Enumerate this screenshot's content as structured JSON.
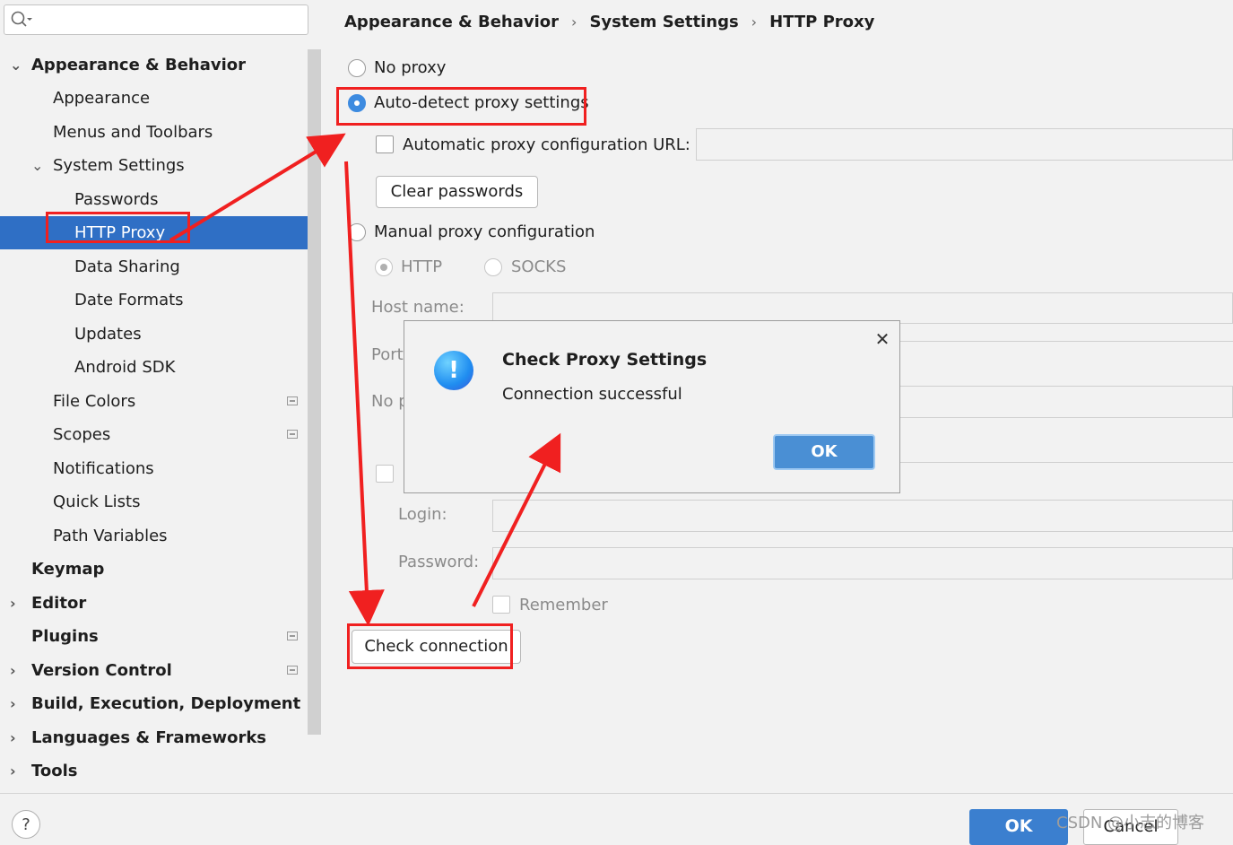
{
  "sidebar": {
    "items": [
      {
        "label": "Appearance & Behavior",
        "bold": true,
        "expanded": true
      },
      {
        "label": "Appearance"
      },
      {
        "label": "Menus and Toolbars"
      },
      {
        "label": "System Settings",
        "expanded": true
      },
      {
        "label": "Passwords"
      },
      {
        "label": "HTTP Proxy",
        "selected": true
      },
      {
        "label": "Data Sharing"
      },
      {
        "label": "Date Formats"
      },
      {
        "label": "Updates"
      },
      {
        "label": "Android SDK"
      },
      {
        "label": "File Colors"
      },
      {
        "label": "Scopes"
      },
      {
        "label": "Notifications"
      },
      {
        "label": "Quick Lists"
      },
      {
        "label": "Path Variables"
      },
      {
        "label": "Keymap",
        "bold": true
      },
      {
        "label": "Editor",
        "bold": true
      },
      {
        "label": "Plugins",
        "bold": true
      },
      {
        "label": "Version Control",
        "bold": true
      },
      {
        "label": "Build, Execution, Deployment",
        "bold": true
      },
      {
        "label": "Languages & Frameworks",
        "bold": true
      },
      {
        "label": "Tools",
        "bold": true
      }
    ]
  },
  "breadcrumb": [
    "Appearance & Behavior",
    "System Settings",
    "HTTP Proxy"
  ],
  "proxy": {
    "no_proxy": "No proxy",
    "auto_detect": "Auto-detect proxy settings",
    "auto_config_url": "Automatic proxy configuration URL:",
    "clear_passwords": "Clear passwords",
    "manual": "Manual proxy configuration",
    "http": "HTTP",
    "socks": "SOCKS",
    "host_name": "Host name:",
    "port": "Port",
    "no_proxy_for": "No p",
    "login": "Login:",
    "password": "Password:",
    "remember": "Remember",
    "check_connection": "Check connection"
  },
  "dialog": {
    "title": "Check Proxy Settings",
    "message": "Connection successful",
    "ok": "OK",
    "close": "✕"
  },
  "footer": {
    "help": "?",
    "ok": "OK",
    "cancel": "Cancel",
    "watermark": "CSDN @小志的博客"
  },
  "colors": {
    "selection": "#2f6fc5",
    "annotation": "#f02020",
    "accent": "#3d8be0"
  }
}
